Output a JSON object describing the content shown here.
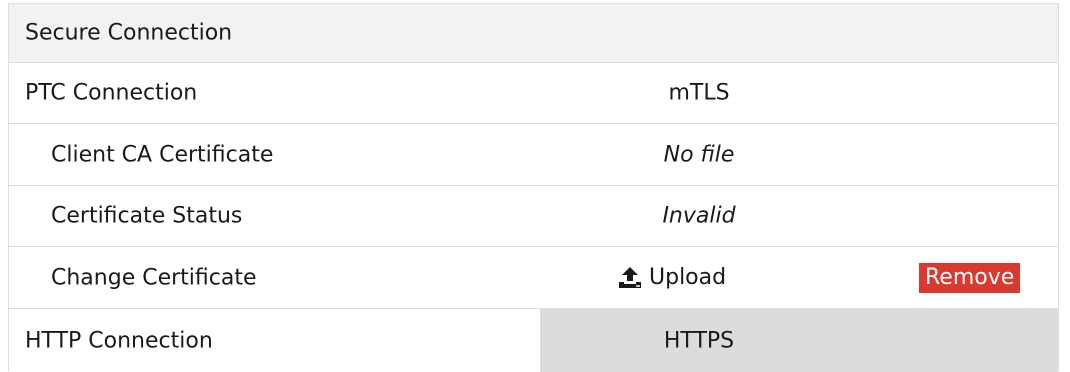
{
  "section": {
    "title": "Secure Connection"
  },
  "rows": {
    "ptc_connection": {
      "label": "PTC Connection",
      "value": "mTLS"
    },
    "client_ca_certificate": {
      "label": "Client CA Certificate",
      "value": "No file"
    },
    "certificate_status": {
      "label": "Certificate Status",
      "value": "Invalid"
    },
    "change_certificate": {
      "label": "Change Certificate",
      "upload_label": "Upload",
      "upload_icon": "upload-icon",
      "remove_label": "Remove"
    },
    "http_connection": {
      "label": "HTTP Connection",
      "value": "HTTPS"
    }
  },
  "colors": {
    "header_background": "#f2f2f2",
    "selected_value_background": "#dcdcdc",
    "remove_button_background": "#d9392f",
    "remove_button_text": "#ffffff",
    "divider": "#dddddd"
  }
}
